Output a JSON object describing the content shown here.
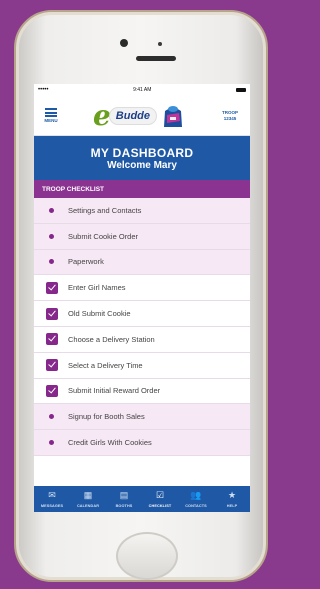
{
  "status_bar": {
    "signal": "•••••",
    "time": "9:41 AM"
  },
  "app_bar": {
    "menu_label": "MENU",
    "logo_e": "e",
    "logo_text": "Budde",
    "troop_label": "TROOP",
    "troop_number": "12345"
  },
  "dashboard": {
    "title": "MY DASHBOARD",
    "welcome": "Welcome Mary"
  },
  "checklist": {
    "section_title": "TROOP CHECKLIST",
    "items": [
      {
        "label": "Settings and Contacts",
        "done": false
      },
      {
        "label": "Submit Cookie Order",
        "done": false
      },
      {
        "label": "Paperwork",
        "done": false
      },
      {
        "label": "Enter Girl Names",
        "done": true
      },
      {
        "label": "Old Submit Cookie",
        "done": true
      },
      {
        "label": "Choose a Delivery Station",
        "done": true
      },
      {
        "label": "Select a Delivery Time",
        "done": true
      },
      {
        "label": "Submit Initial Reward Order",
        "done": true
      },
      {
        "label": "Signup for Booth Sales",
        "done": false
      },
      {
        "label": "Credit Girls With Cookies",
        "done": false
      }
    ]
  },
  "tabs": [
    {
      "label": "MESSAGES",
      "icon": "messages-icon",
      "glyph": "✉"
    },
    {
      "label": "CALENDAR",
      "icon": "calendar-icon",
      "glyph": "▦"
    },
    {
      "label": "BOOTHS",
      "icon": "booths-icon",
      "glyph": "▤"
    },
    {
      "label": "CHECKLIST",
      "icon": "checklist-icon",
      "glyph": "☑",
      "active": true
    },
    {
      "label": "CONTACTS",
      "icon": "contacts-icon",
      "glyph": "👥"
    },
    {
      "label": "HELP",
      "icon": "help-icon",
      "glyph": "★"
    }
  ],
  "colors": {
    "background": "#8a3a8c",
    "primary_blue": "#1f58a4",
    "accent_purple": "#85278b",
    "row_pending": "#f7e8f5",
    "logo_green": "#6a9f1e"
  }
}
